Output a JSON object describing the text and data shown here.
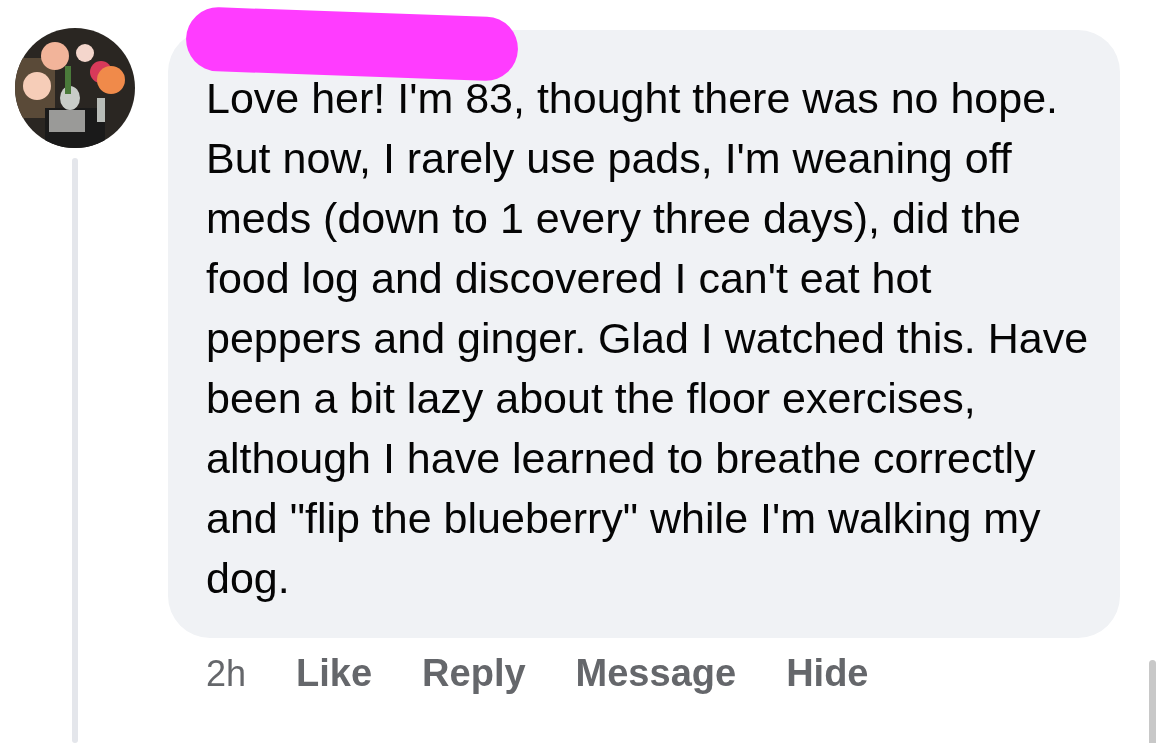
{
  "comment": {
    "author_redacted": true,
    "text": "Love her! I'm 83, thought there was no hope. But now, I rarely use pads, I'm weaning off meds (down to 1 every three days), did the food log and discovered I can't eat hot peppers and ginger. Glad I watched this. Have been a bit lazy about the floor exercises, although I have learned to breathe correctly and \"flip the blueberry\" while I'm walking my dog.",
    "time": "2h",
    "actions": [
      "Like",
      "Reply",
      "Message",
      "Hide"
    ]
  }
}
